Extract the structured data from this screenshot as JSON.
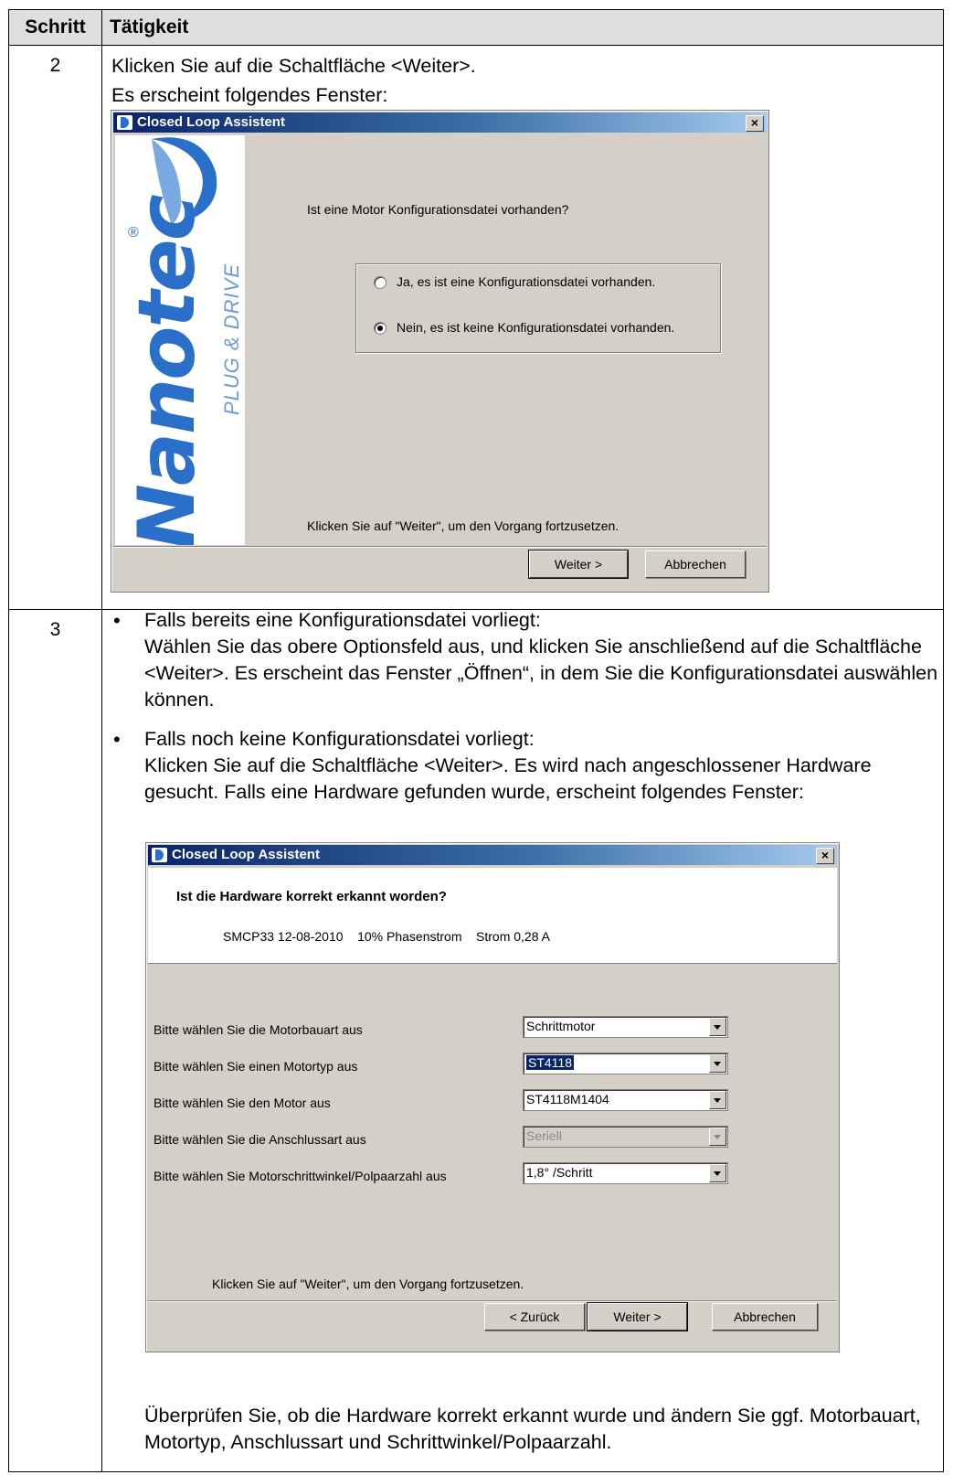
{
  "table": {
    "header_step": "Schritt",
    "header_activity": "Tätigkeit"
  },
  "row2": {
    "step": "2",
    "line1": "Klicken Sie auf die Schaltfläche <Weiter>.",
    "line2": "Es erscheint folgendes Fenster:",
    "dialog": {
      "title": "Closed Loop Assistent",
      "close": "×",
      "question": "Ist eine Motor Konfigurationsdatei vorhanden?",
      "options": [
        {
          "label": "Ja, es ist eine Konfigurationsdatei vorhanden.",
          "checked": false
        },
        {
          "label": "Nein, es ist keine Konfigurationsdatei vorhanden.",
          "checked": true
        }
      ],
      "footer": "Klicken Sie auf \"Weiter\", um den Vorgang fortzusetzen.",
      "next_button": "Weiter >",
      "cancel_button": "Abbrechen",
      "logo_text": "Nanotec",
      "logo_sub": "PLUG & DRIVE",
      "logo_reg": "®"
    }
  },
  "row3": {
    "step": "3",
    "bullet1_head": "Falls bereits eine Konfigurationsdatei vorliegt:",
    "bullet1_body": "Wählen Sie das obere Optionsfeld aus, und klicken Sie anschließend auf die Schaltfläche <Weiter>. Es erscheint das Fenster „Öffnen“, in dem Sie die Konfigurationsdatei auswählen können.",
    "bullet2_head": "Falls noch keine Konfigurationsdatei vorliegt:",
    "bullet2_body": "Klicken Sie auf die Schaltfläche <Weiter>. Es wird nach angeschlossener Hardware gesucht. Falls eine Hardware gefunden wurde, erscheint folgendes Fenster:",
    "dialog": {
      "title": "Closed Loop Assistent",
      "close": "×",
      "heading": "Ist die Hardware korrekt erkannt worden?",
      "info": "SMCP33 12-08-2010    10% Phasenstrom    Strom 0,28 A",
      "fields": [
        {
          "label": "Bitte wählen Sie die Motorbauart aus",
          "value": "Schrittmotor",
          "selected": false,
          "disabled": false
        },
        {
          "label": "Bitte wählen Sie einen Motortyp aus",
          "value": "ST4118",
          "selected": true,
          "disabled": false
        },
        {
          "label": "Bitte wählen Sie den Motor aus",
          "value": "ST4118M1404",
          "selected": false,
          "disabled": false
        },
        {
          "label": "Bitte wählen Sie die Anschlussart aus",
          "value": "Seriell",
          "selected": false,
          "disabled": true
        },
        {
          "label": "Bitte wählen Sie Motorschrittwinkel/Polpaarzahl aus",
          "value": "1,8° /Schritt",
          "selected": false,
          "disabled": false
        }
      ],
      "footer": "Klicken Sie auf \"Weiter\", um den Vorgang fortzusetzen.",
      "back_button": "< Zurück",
      "next_button": "Weiter >",
      "cancel_button": "Abbrechen"
    },
    "closing": "Überprüfen Sie, ob die Hardware korrekt erkannt wurde und ändern Sie ggf. Motorbauart, Motortyp, Anschlussart und Schrittwinkel/Polpaarzahl."
  }
}
